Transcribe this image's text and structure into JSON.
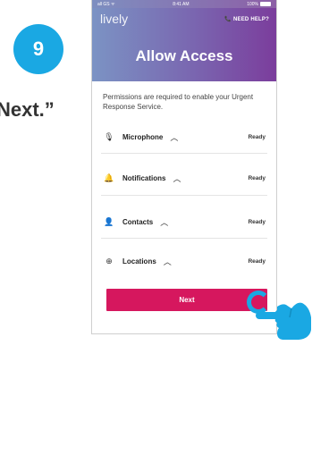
{
  "step": {
    "number": "9",
    "instruction": "Next.”"
  },
  "phone": {
    "status_bar": {
      "carrier": "all GS ᯤ",
      "time": "8:41 AM",
      "battery": "100%"
    },
    "brand": "lively",
    "help_label": "NEED HELP?",
    "title": "Allow Access",
    "intro": "Permissions are required to enable your Urgent Response Service.",
    "permissions": [
      {
        "icon": "microphone-icon",
        "label": "Microphone",
        "status": "Ready"
      },
      {
        "icon": "bell-icon",
        "label": "Notifications",
        "status": "Ready"
      },
      {
        "icon": "person-icon",
        "label": "Contacts",
        "status": "Ready"
      },
      {
        "icon": "location-icon",
        "label": "Locations",
        "status": "Ready"
      }
    ],
    "next_label": "Next"
  },
  "colors": {
    "accent_blue": "#1aa8e3",
    "button_pink": "#d6175e",
    "header_purple": "#7b3d9c",
    "header_blue": "#7b93c4"
  }
}
